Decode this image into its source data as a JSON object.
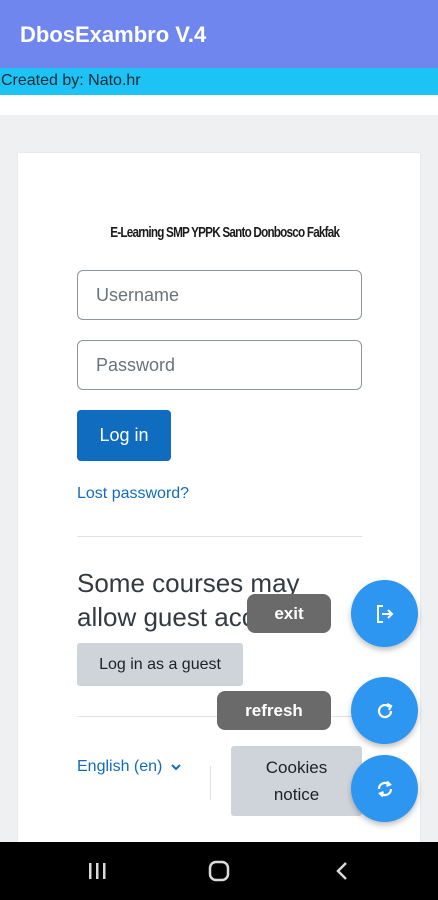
{
  "app": {
    "title": "DbosExambro V.4",
    "created_by": "Created by: Nato.hr"
  },
  "login": {
    "logo_text": "E-Learning SMP YPPK Santo Donbosco Fakfak",
    "username_placeholder": "Username",
    "password_placeholder": "Password",
    "login_label": "Log in",
    "lost_password": "Lost password?",
    "guest_heading_line1": "Some courses may",
    "guest_heading_line2": "allow guest access",
    "guest_button": "Log in as a guest",
    "language": "English (en)",
    "cookies_line1": "Cookies",
    "cookies_line2": "notice"
  },
  "fabs": {
    "exit_label": "exit",
    "refresh_label": "refresh"
  },
  "colors": {
    "app_bar": "#6f86ee",
    "created_bar": "#1ec3f6",
    "primary": "#0f6cbf",
    "fab": "#2d96f0"
  },
  "icons": [
    "exit-icon",
    "refresh-icon",
    "sync-icon",
    "chevron-down-icon",
    "recent-apps-icon",
    "home-icon",
    "back-icon"
  ]
}
